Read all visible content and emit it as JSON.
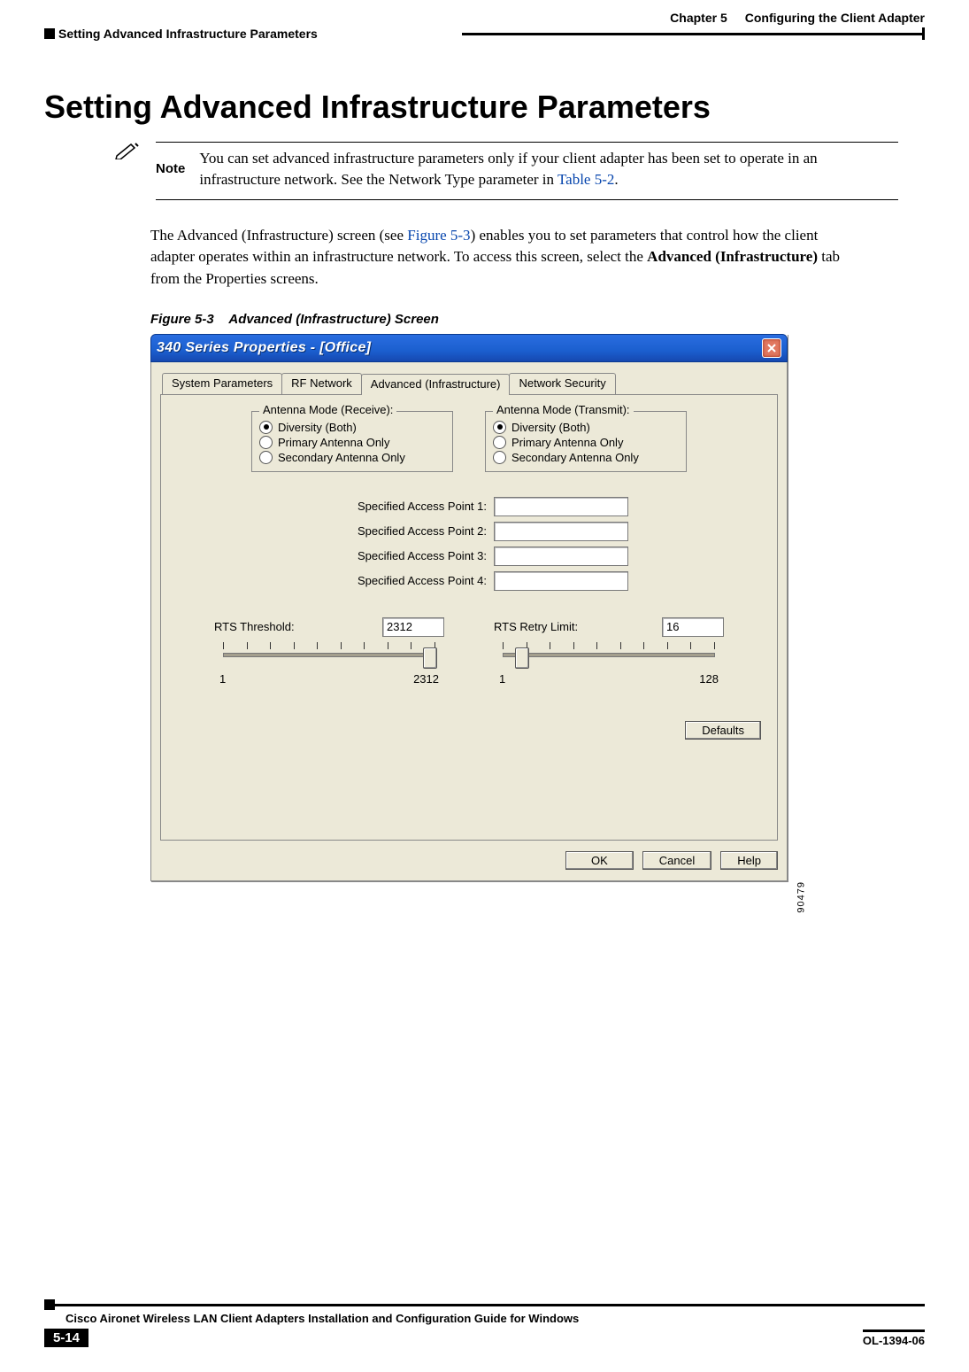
{
  "header": {
    "chapter": "Chapter 5",
    "chapter_title": "Configuring the Client Adapter",
    "section": "Setting Advanced Infrastructure Parameters"
  },
  "heading": "Setting Advanced Infrastructure Parameters",
  "note": {
    "label": "Note",
    "text_a": "You can set advanced infrastructure parameters only if your client adapter has been set to operate in an infrastructure network. See the Network Type parameter in ",
    "link": "Table 5-2",
    "text_b": "."
  },
  "body": {
    "p1_a": "The Advanced (Infrastructure) screen (see ",
    "p1_link": "Figure 5-3",
    "p1_b": ") enables you to set parameters that control how the client adapter operates within an infrastructure network. To access this screen, select the ",
    "p1_bold": "Advanced (Infrastructure)",
    "p1_c": " tab from the Properties screens."
  },
  "figure": {
    "number": "Figure 5-3",
    "caption": "Advanced (Infrastructure) Screen",
    "image_id": "90479"
  },
  "dialog": {
    "title": "340 Series Properties - [Office]",
    "tabs": [
      "System Parameters",
      "RF Network",
      "Advanced (Infrastructure)",
      "Network Security"
    ],
    "active_tab": 2,
    "antenna_rx": {
      "title": "Antenna Mode (Receive):",
      "options": [
        "Diversity (Both)",
        "Primary Antenna Only",
        "Secondary Antenna Only"
      ],
      "selected": 0
    },
    "antenna_tx": {
      "title": "Antenna Mode (Transmit):",
      "options": [
        "Diversity (Both)",
        "Primary Antenna Only",
        "Secondary Antenna Only"
      ],
      "selected": 0
    },
    "access_points": {
      "labels": [
        "Specified Access Point 1:",
        "Specified Access Point 2:",
        "Specified Access Point 3:",
        "Specified Access Point 4:"
      ],
      "values": [
        "",
        "",
        "",
        ""
      ]
    },
    "rts_threshold": {
      "label": "RTS Threshold:",
      "value": "2312",
      "min": "1",
      "max": "2312"
    },
    "rts_retry": {
      "label": "RTS Retry Limit:",
      "value": "16",
      "min": "1",
      "max": "128"
    },
    "buttons": {
      "defaults": "Defaults",
      "ok": "OK",
      "cancel": "Cancel",
      "help": "Help"
    }
  },
  "footer": {
    "book": "Cisco Aironet Wireless LAN Client Adapters Installation and Configuration Guide for Windows",
    "page": "5-14",
    "doc_id": "OL-1394-06"
  }
}
